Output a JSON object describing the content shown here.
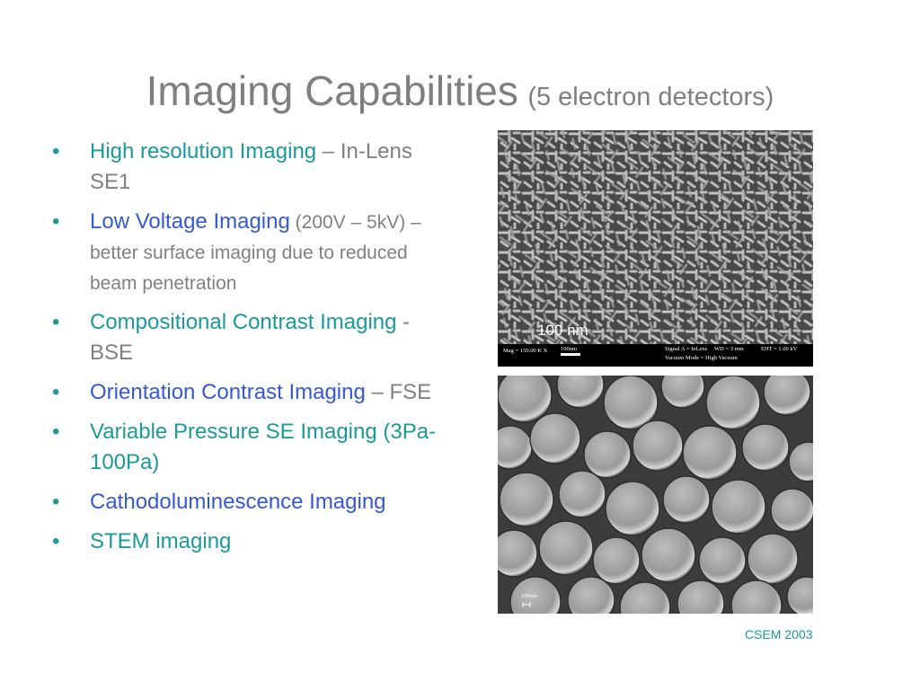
{
  "slide": {
    "title": "Imaging Capabilities",
    "subtitle": "(5 electron detectors)",
    "footer": "CSEM 2003"
  },
  "bullets": [
    {
      "highlight": "High resolution Imaging",
      "rest": " – In-Lens SE1",
      "highlight_color": "#1a9a9a",
      "rest_small": false
    },
    {
      "highlight": "Low Voltage Imaging",
      "rest": " (200V – 5kV) – better surface imaging due to reduced beam penetration",
      "highlight_color": "#3558d8",
      "rest_small": true
    },
    {
      "highlight": "Compositional Contrast Imaging",
      "rest": " - BSE",
      "highlight_color": "#1a9a9a",
      "rest_small": false
    },
    {
      "highlight": "Orientation Contrast Imaging",
      "rest": " – FSE",
      "highlight_color": "#3558d8",
      "rest_small": false
    },
    {
      "highlight": "Variable Pressure SE Imaging (3Pa-100Pa)",
      "rest": "",
      "highlight_color": "#1a9a9a",
      "rest_small": false
    },
    {
      "highlight": "Cathodoluminescence Imaging",
      "rest": "",
      "highlight_color": "#3558d8",
      "rest_small": false
    },
    {
      "highlight": "STEM imaging",
      "rest": "",
      "highlight_color": "#1a9a9a",
      "rest_small": false
    }
  ],
  "sem1": {
    "scale_label": "100 nm",
    "info_mag": "Mag = 150.00 K X",
    "info_bar": "100nm",
    "info_signal": "Signal A = InLens",
    "info_wd": "WD =    3 mm",
    "info_eht": "EHT =  1.00 kV",
    "info_vacuum": "Vacuum Mode = High Vacuum"
  },
  "sem2": {
    "scale_label": "100nm"
  },
  "colors": {
    "title": "#7f7f7f",
    "teal": "#1a9a9a",
    "blue": "#3558d8",
    "body_gray": "#808080"
  }
}
